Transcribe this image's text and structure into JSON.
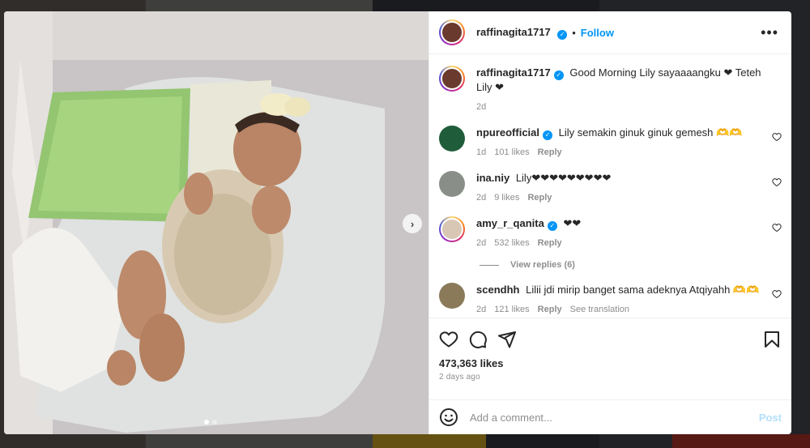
{
  "post": {
    "username": "raffinagita1717",
    "follow_label": "Follow",
    "separator": "•",
    "more_label": "•••",
    "next_label": "›",
    "caption": "Good Morning Lily sayaaaangku ❤ Teteh Lily ❤",
    "caption_time": "2d",
    "likes": "473,363 likes",
    "date": "2 days ago"
  },
  "comments": [
    {
      "username": "npureofficial",
      "verified": true,
      "text": "Lily semakin ginuk ginuk gemesh 🫶🫶",
      "time": "1d",
      "likes": "101 likes",
      "reply": "Reply"
    },
    {
      "username": "ina.niy",
      "verified": false,
      "text": "Lily❤❤❤❤❤❤❤❤❤",
      "time": "2d",
      "likes": "9 likes",
      "reply": "Reply"
    },
    {
      "username": "amy_r_qanita",
      "verified": true,
      "text": "❤❤",
      "time": "2d",
      "likes": "532 likes",
      "reply": "Reply"
    },
    {
      "username": "scendhh",
      "verified": false,
      "text": "Lilii jdi mirip banget sama adeknya Atqiyahh 🫶🫶",
      "time": "2d",
      "likes": "121 likes",
      "reply": "Reply",
      "translate": "See translation"
    }
  ],
  "view_replies": "View replies (6)",
  "add_comment": {
    "placeholder": "Add a comment...",
    "post_label": "Post"
  },
  "icons": [
    "heart-icon",
    "comment-icon",
    "share-icon",
    "bookmark-icon",
    "emoji-icon",
    "verified-badge-icon",
    "more-options-icon",
    "chevron-right-icon"
  ],
  "colors": {
    "accent": "#0095f6",
    "text": "#262626",
    "secondary": "#8e8e8e",
    "post_disabled": "#b2dffc"
  }
}
